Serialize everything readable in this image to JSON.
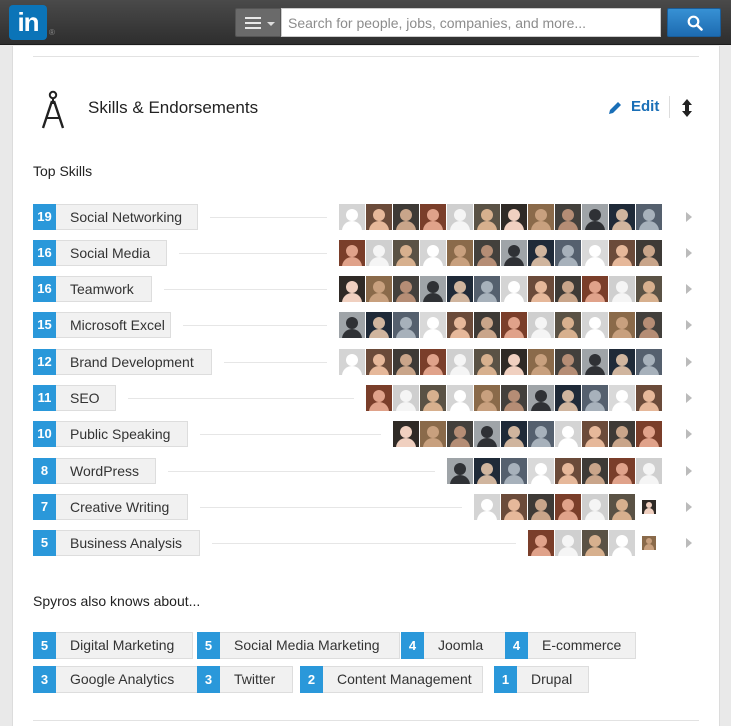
{
  "header": {
    "logo": "in",
    "logo_reg": "®",
    "search_placeholder": "Search for people, jobs, companies, and more..."
  },
  "section": {
    "title": "Skills & Endorsements",
    "edit_label": "Edit"
  },
  "top_skills_heading": "Top Skills",
  "skills": [
    {
      "count": "19",
      "name": "Social Networking",
      "faces": 12
    },
    {
      "count": "16",
      "name": "Social Media",
      "faces": 12
    },
    {
      "count": "16",
      "name": "Teamwork",
      "faces": 12
    },
    {
      "count": "15",
      "name": "Microsoft Excel",
      "faces": 12
    },
    {
      "count": "12",
      "name": "Brand Development",
      "faces": 12
    },
    {
      "count": "11",
      "name": "SEO",
      "faces": 11
    },
    {
      "count": "10",
      "name": "Public Speaking",
      "faces": 10
    },
    {
      "count": "8",
      "name": "WordPress",
      "faces": 8
    },
    {
      "count": "7",
      "name": "Creative Writing",
      "faces": 7
    },
    {
      "count": "5",
      "name": "Business Analysis",
      "faces": 5
    }
  ],
  "also_knows_heading": "Spyros also knows about...",
  "also_knows": [
    {
      "count": "5",
      "name": "Digital Marketing"
    },
    {
      "count": "5",
      "name": "Social Media Marketing"
    },
    {
      "count": "4",
      "name": "Joomla"
    },
    {
      "count": "4",
      "name": "E-commerce"
    },
    {
      "count": "3",
      "name": "Google Analytics"
    },
    {
      "count": "3",
      "name": "Twitter"
    },
    {
      "count": "2",
      "name": "Content Management"
    },
    {
      "count": "1",
      "name": "Drupal"
    }
  ],
  "colors": {
    "brand": "#0b74b8",
    "count_badge": "#2a98da",
    "edit_link": "#1a6fb7"
  },
  "icons": {
    "menu": "menu-icon",
    "search": "search-icon",
    "section": "compass-icon",
    "edit": "pencil-icon",
    "reorder": "reorder-arrows-icon",
    "more": "chevron-right-icon"
  }
}
